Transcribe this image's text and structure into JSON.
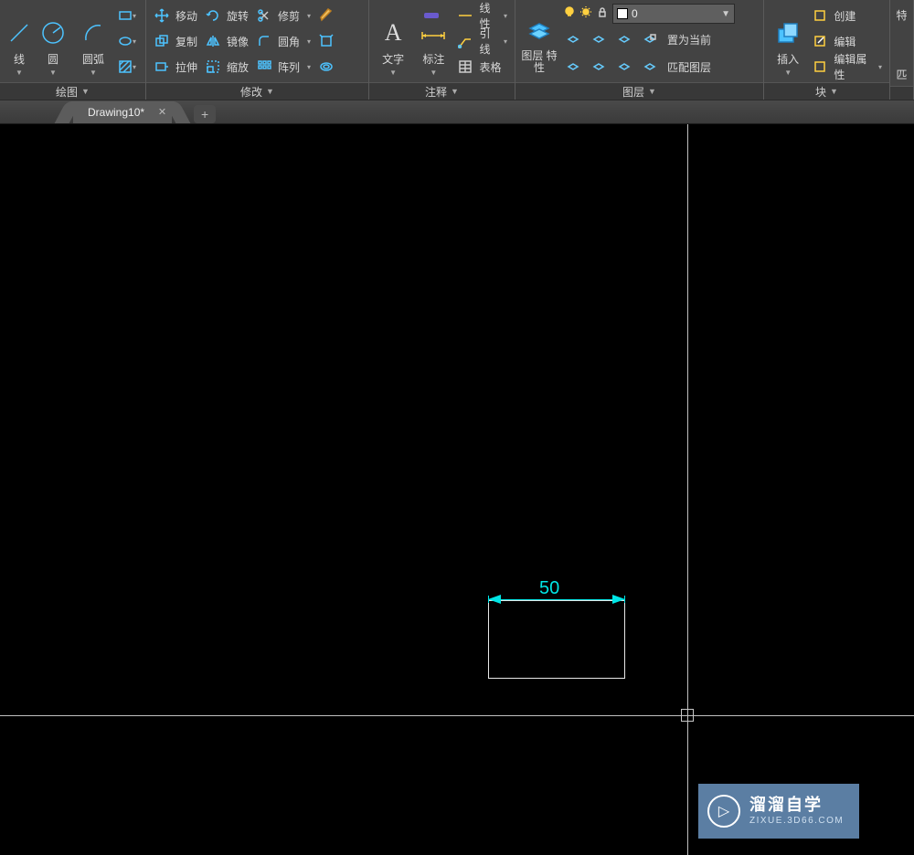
{
  "ribbon": {
    "draw": {
      "title": "绘图",
      "line": "线",
      "circle": "圆",
      "arc": "圆弧"
    },
    "modify": {
      "title": "修改",
      "move": "移动",
      "copy": "复制",
      "stretch": "拉伸",
      "rotate": "旋转",
      "mirror": "镜像",
      "scale": "缩放",
      "trim": "修剪",
      "fillet": "圆角",
      "array": "阵列"
    },
    "annot": {
      "title": "注释",
      "text": "文字",
      "dim": "标注",
      "linetype": "线性",
      "leader": "引线",
      "table": "表格"
    },
    "layer": {
      "title": "图层",
      "props": "图层\n特性",
      "setcurrent": "置为当前",
      "matchlayer": "匹配图层",
      "value": "0"
    },
    "block": {
      "title": "块",
      "insert": "插入",
      "create": "创建",
      "edit": "编辑",
      "editattr": "编辑属性"
    },
    "props": {
      "partial": "特"
    },
    "match": {
      "partial": "匹"
    }
  },
  "tabs": {
    "name": "Drawing10*"
  },
  "dimension": {
    "value": "50"
  },
  "watermark": {
    "title": "溜溜自学",
    "sub": "ZIXUE.3D66.COM"
  }
}
